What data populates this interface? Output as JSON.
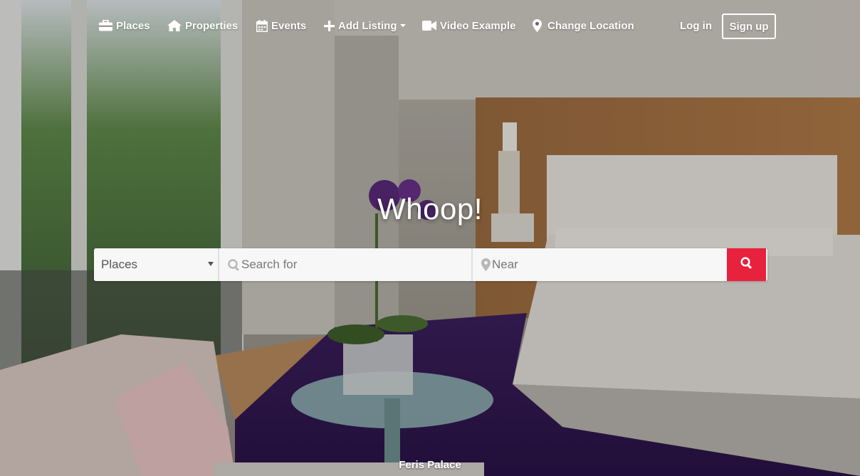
{
  "nav": {
    "places": "Places",
    "properties": "Properties",
    "events": "Events",
    "add_listing": "Add Listing",
    "video_example": "Video Example",
    "change_location": "Change Location",
    "login": "Log in",
    "signup": "Sign up"
  },
  "icons": {
    "places": "briefcase-icon",
    "properties": "home-icon",
    "events": "calendar-icon",
    "add_listing": "plus-icon",
    "video_example": "video-camera-icon",
    "change_location": "map-marker-icon",
    "search_field": "search-icon",
    "near_field": "map-marker-icon",
    "search_button": "search-icon"
  },
  "hero": {
    "title": "Whoop!",
    "caption": "Feris Palace"
  },
  "search": {
    "type_selected": "Places",
    "search_placeholder": "Search for",
    "near_placeholder": "Near"
  },
  "colors": {
    "accent": "#e8213c",
    "nav_text": "#ffffff"
  }
}
